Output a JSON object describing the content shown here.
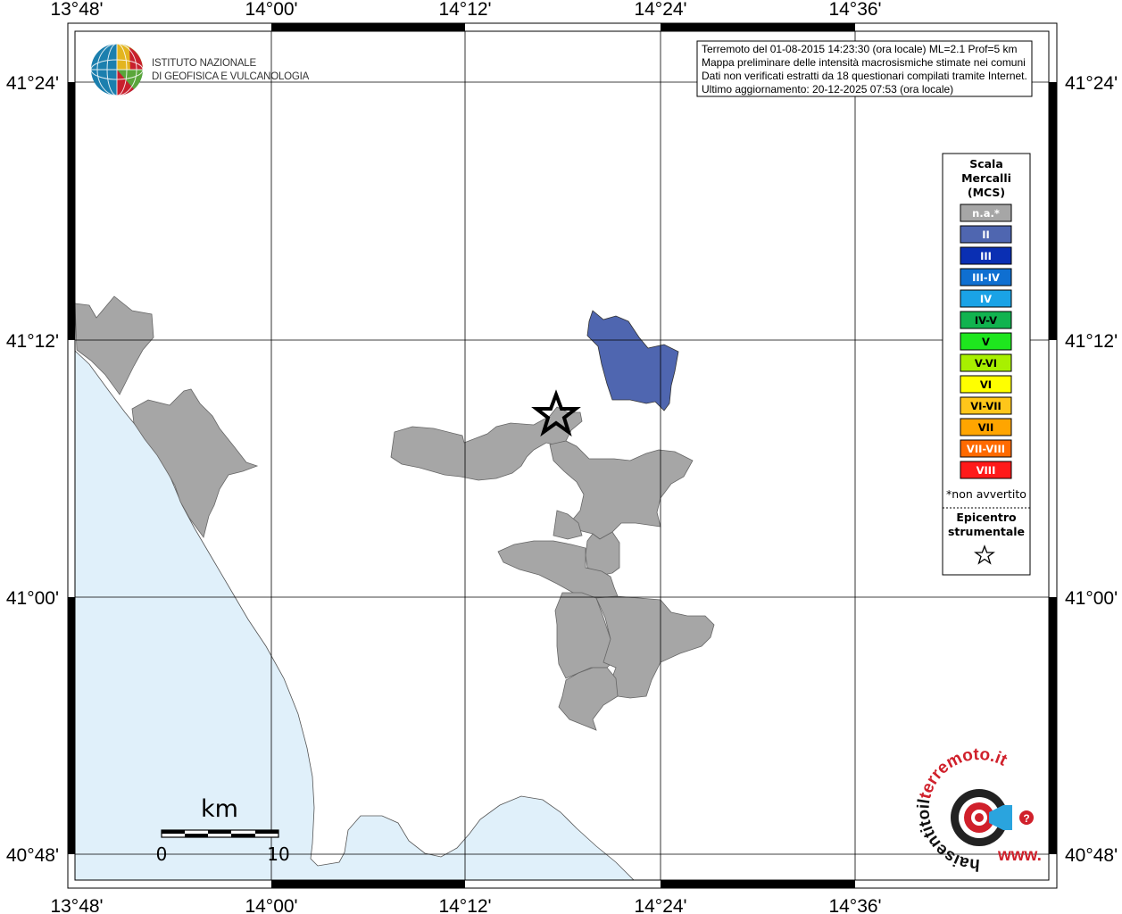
{
  "map": {
    "lon_labels": [
      "13°48'",
      "14°00'",
      "14°12'",
      "14°24'",
      "14°36'"
    ],
    "lat_labels": [
      "41°24'",
      "41°12'",
      "41°00'",
      "40°48'"
    ],
    "colors": {
      "sea": "#e0f0fa",
      "na": "#a6a6a6",
      "intensity_II": "#4f66b0",
      "frame": "#000000"
    }
  },
  "info_box": {
    "lines": [
      "Terremoto del 01-08-2015 14:23:30 (ora locale) ML=2.1 Prof=5 km",
      "Mappa preliminare delle intensità macrosismiche stimate nei comuni",
      "Dati non verificati estratti da 18 questionari compilati tramite Internet.",
      "Ultimo aggiornamento: 20-12-2025 07:53 (ora locale)"
    ]
  },
  "logo": {
    "line1": "ISTITUTO NAZIONALE",
    "line2": "DI GEOFISICA E VULCANOLOGIA"
  },
  "legend": {
    "title": [
      "Scala",
      "Mercalli",
      "(MCS)"
    ],
    "classes": [
      {
        "label": "n.a.*",
        "color": "#a6a6a6"
      },
      {
        "label": "II",
        "color": "#4f66b0"
      },
      {
        "label": "III",
        "color": "#0a2fb3"
      },
      {
        "label": "III-IV",
        "color": "#0f6fd1"
      },
      {
        "label": "IV",
        "color": "#1aa3e6"
      },
      {
        "label": "IV-V",
        "color": "#11b34f"
      },
      {
        "label": "V",
        "color": "#1ee61e"
      },
      {
        "label": "V-VI",
        "color": "#a8f000"
      },
      {
        "label": "VI",
        "color": "#ffff00"
      },
      {
        "label": "VI-VII",
        "color": "#ffc61a"
      },
      {
        "label": "VII",
        "color": "#ffa500"
      },
      {
        "label": "VII-VIII",
        "color": "#ff6a00"
      },
      {
        "label": "VIII",
        "color": "#ff1a1a"
      }
    ],
    "note": "*non avvertito",
    "epicenter": [
      "Epicentro",
      "strumentale"
    ]
  },
  "scale_bar": {
    "unit": "km",
    "ticks": [
      "0",
      "10"
    ]
  },
  "site_logo": {
    "text_black": "haisentitoil",
    "text_red": "terremoto.it",
    "text_bottom": "www."
  }
}
